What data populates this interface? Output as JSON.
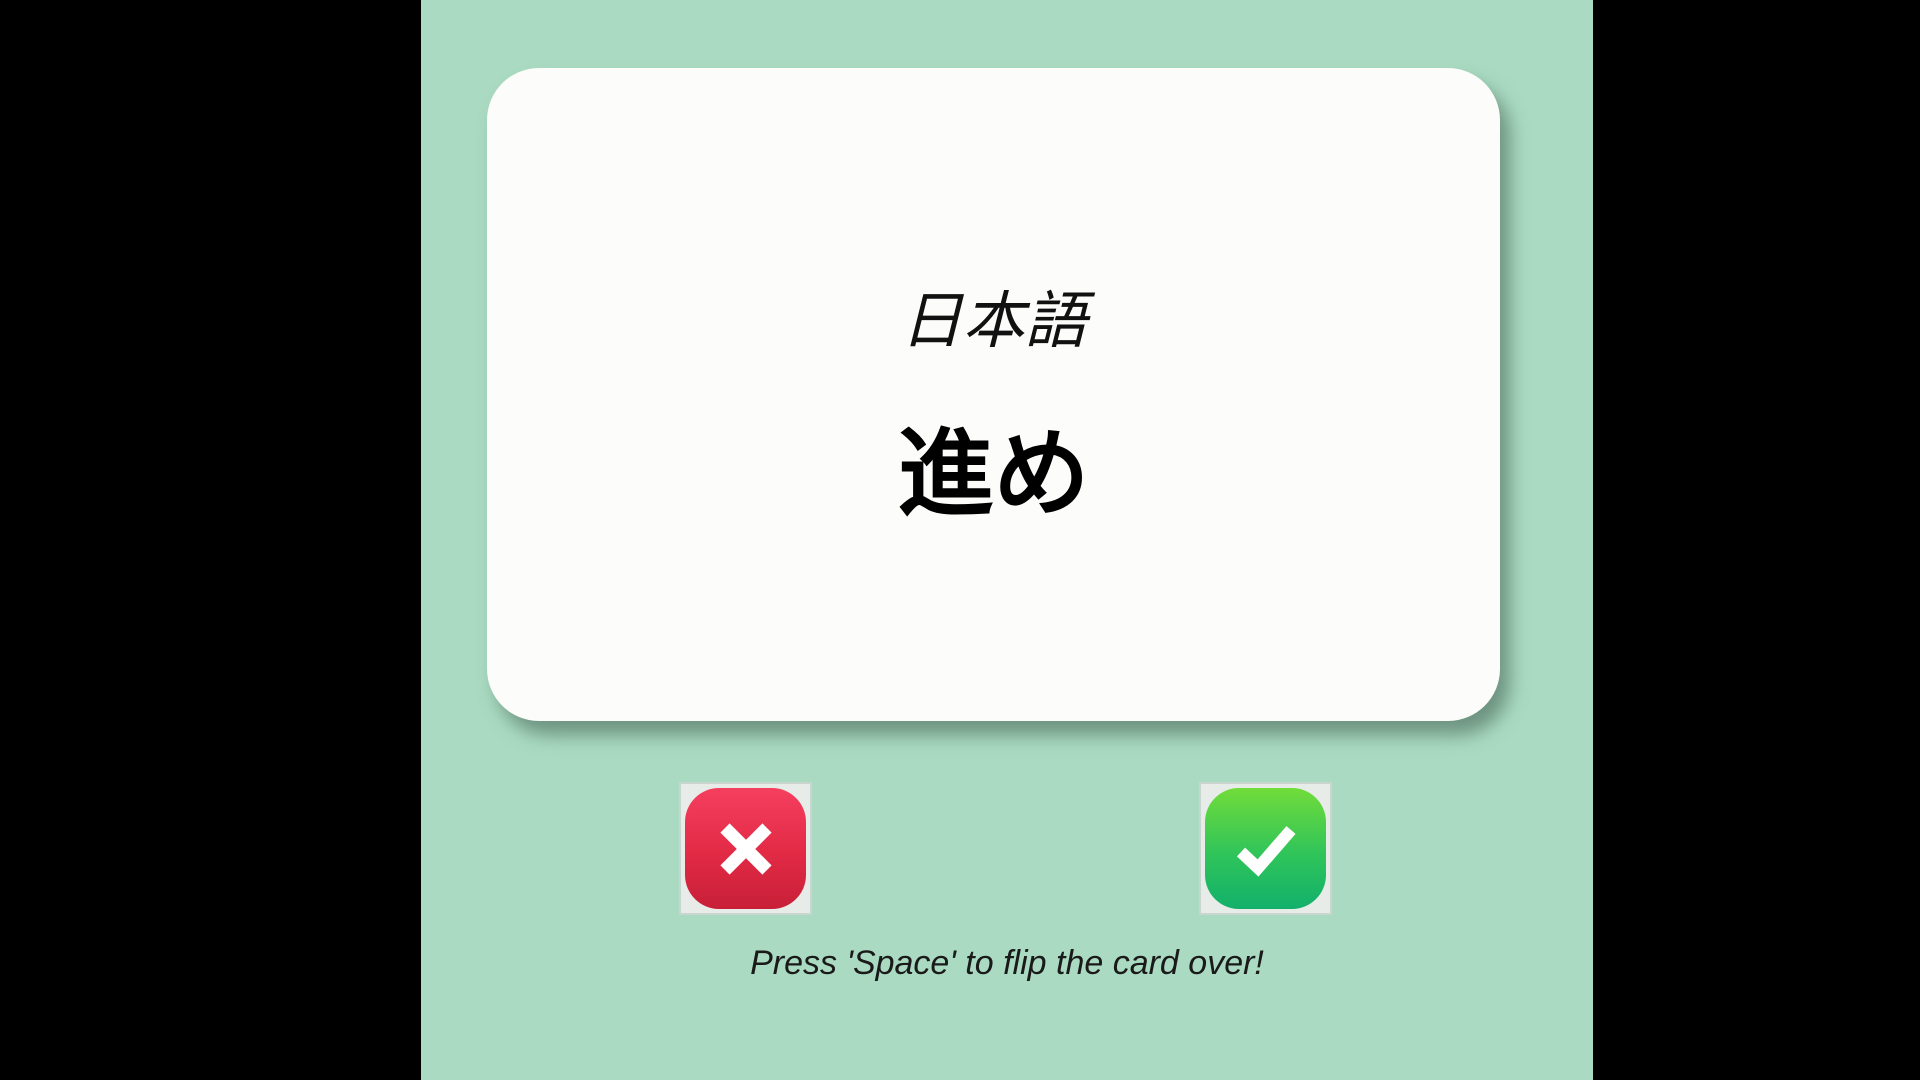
{
  "card": {
    "language": "日本語",
    "word": "進め"
  },
  "buttons": {
    "wrong": {
      "icon": "close-icon",
      "color": "#e22a45"
    },
    "right": {
      "icon": "checkmark-icon",
      "color": "#2fc45a"
    }
  },
  "hint": "Press 'Space' to flip the card over!",
  "colors": {
    "background": "#aadbc2",
    "card": "#fcfcfa",
    "letterbox": "#000000"
  }
}
